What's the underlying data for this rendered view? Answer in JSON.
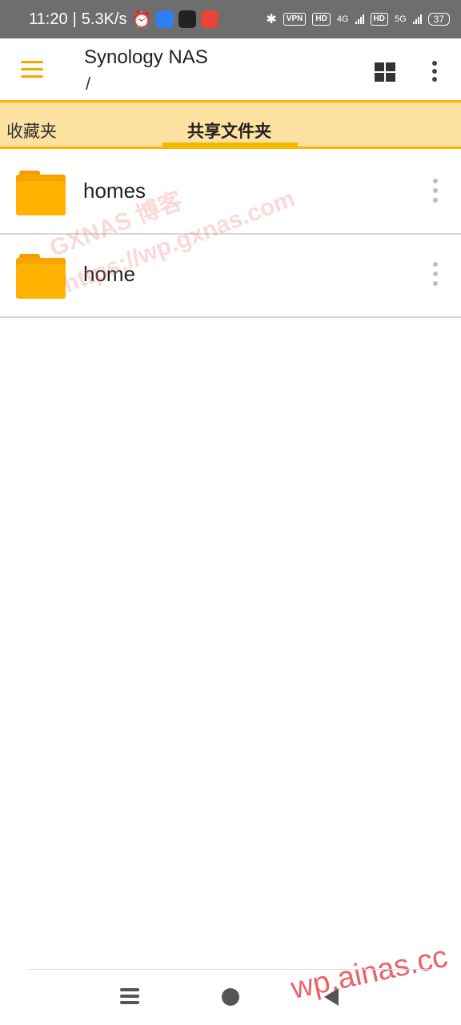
{
  "status_bar": {
    "time": "11:20",
    "net_speed": "5.3K/s",
    "vpn": "VPN",
    "hd1": "HD",
    "net1": "4G",
    "hd2": "HD",
    "net2": "5G",
    "battery": "37",
    "app_icon_colors": [
      "#2f7ff0",
      "#222222",
      "#e8443a"
    ]
  },
  "app_bar": {
    "title": "Synology NAS",
    "path": "/",
    "accent": "#f5b700"
  },
  "tabs": [
    {
      "label": "收藏夹",
      "active": false
    },
    {
      "label": "共享文件夹",
      "active": true
    }
  ],
  "folders": [
    {
      "name": "homes"
    },
    {
      "name": "home"
    }
  ],
  "watermarks": {
    "line1": "GXNAS 博客",
    "line2": "https://wp.gxnas.com",
    "corner": "wp.ainas.cc"
  }
}
